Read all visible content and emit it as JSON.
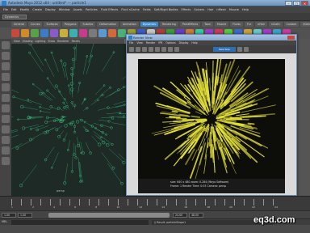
{
  "app": {
    "window_title": "Autodesk Maya 2012 x64 - untitled* --- particle1",
    "window_buttons": [
      "–",
      "□",
      "×"
    ]
  },
  "menubar": {
    "items": [
      "File",
      "Edit",
      "Modify",
      "Create",
      "Display",
      "Window",
      "Assets",
      "Particles",
      "Fluid Effects",
      "Fluid nCache",
      "Fields",
      "Soft/Rigid Bodies",
      "Effects",
      "Solvers",
      "Hair",
      "nMesh",
      "Muscle",
      "Help"
    ]
  },
  "statusline": {
    "mode": "Dynamics"
  },
  "shelf": {
    "tabs": [
      "General",
      "Curves",
      "Surfaces",
      "Polygons",
      "Subdivs",
      "Deformation",
      "Animation",
      "Dynamics",
      "Rendering",
      "PaintEffects",
      "Toon",
      "Muscle",
      "Fluids",
      "Fur",
      "nHair",
      "nCloth",
      "Custom",
      "XGen",
      "Bifrost",
      "Mash",
      "Arnold"
    ],
    "active_tab": "Dynamics",
    "icon_colors": [
      "#c64a3c",
      "#d08a2a",
      "#5aa04a",
      "#3c7cc6",
      "#8a5ac6",
      "#c6b03c",
      "#3cb0b0",
      "#c63c8a",
      "#7a7a7a",
      "#5a9ad0",
      "#d06a3c",
      "#4ab07a",
      "#9a9a3c",
      "#3c5ac6",
      "#c6c6c6",
      "#b03c3c",
      "#3c9a3c",
      "#6a3cc6",
      "#c67a3c",
      "#3cc69a",
      "#9a3cc6",
      "#c63c5a",
      "#5ac63c",
      "#3c6ac6",
      "#c6a03c",
      "#6ac6c6",
      "#a03cc6",
      "#3ca0c6",
      "#c63ca0"
    ]
  },
  "viewport": {
    "menu": [
      "View",
      "Shading",
      "Lighting",
      "Show",
      "Renderer",
      "Panels"
    ],
    "camera": "persp",
    "particle_color": "#3fd68a",
    "background": "#1d2a26"
  },
  "render_view": {
    "title": "Render View",
    "menu": [
      "File",
      "View",
      "Render",
      "IPR",
      "Options",
      "Display",
      "Help"
    ],
    "tool_tag": "Real Size",
    "footer_line1": "size: 640 x 480   zoom: 0.284    (Maya Software)",
    "footer_line2": "Frame: 1      Render Time: 0:03      Camera: persp",
    "streak_color": "#e6e23a",
    "background": "#0d0d0a"
  },
  "timeline": {
    "tick_labels": [
      "1",
      "2",
      "4",
      "6",
      "8",
      "10",
      "12",
      "14",
      "16",
      "18",
      "20",
      "22",
      "24"
    ],
    "current_frame": "1.00"
  },
  "range": {
    "start": "1.00",
    "inner_start": "1.00",
    "inner_end": "24.00",
    "end": "48.00"
  },
  "cmdline": {
    "label": "MEL",
    "result": "// Result: particleShape1"
  },
  "watermark": "eq3d.com"
}
